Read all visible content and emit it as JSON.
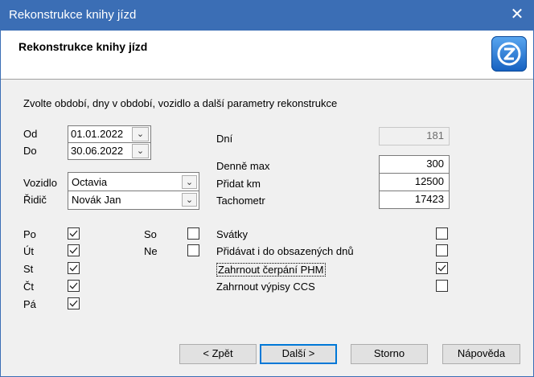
{
  "window": {
    "title": "Rekonstrukce knihy jízd",
    "close_glyph": "✕"
  },
  "header": {
    "title": "Rekonstrukce knihy jízd",
    "logo_icon": "app-logo-icon"
  },
  "instructions": "Zvolte období, dny v období, vozidlo a další parametry rekonstrukce",
  "period": {
    "from_label": "Od",
    "from_value": "01.01.2022",
    "to_label": "Do",
    "to_value": "30.06.2022"
  },
  "vehicle": {
    "label": "Vozidlo",
    "value": "Octavia"
  },
  "driver": {
    "label": "Řidič",
    "value": "Novák Jan"
  },
  "days": [
    {
      "label": "Po",
      "checked": true
    },
    {
      "label": "Út",
      "checked": true
    },
    {
      "label": "St",
      "checked": true
    },
    {
      "label": "Čt",
      "checked": true
    },
    {
      "label": "Pá",
      "checked": true
    },
    {
      "label": "So",
      "checked": false
    },
    {
      "label": "Ne",
      "checked": false
    }
  ],
  "stats": {
    "days_label": "Dní",
    "days_value": "181",
    "daily_max_label": "Denně max",
    "daily_max_value": "300",
    "add_km_label": "Přidat km",
    "add_km_value": "12500",
    "odometer_label": "Tachometr",
    "odometer_value": "17423"
  },
  "options": [
    {
      "label": "Svátky",
      "checked": false
    },
    {
      "label": "Přidávat i do obsazených dnů",
      "checked": false
    },
    {
      "label": "Zahrnout čerpání PHM",
      "checked": true
    },
    {
      "label": "Zahrnout výpisy CCS",
      "checked": false
    }
  ],
  "buttons": {
    "back_label": "< Zpět",
    "next_label": "Další >",
    "cancel_label": "Storno",
    "help_label": "Nápověda"
  }
}
